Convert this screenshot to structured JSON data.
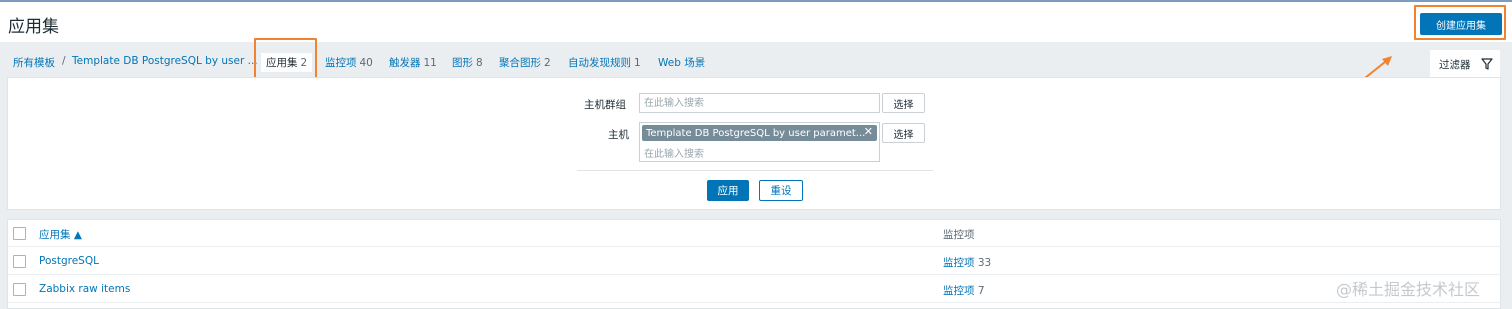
{
  "header": {
    "title": "应用集",
    "create_button": "创建应用集"
  },
  "nav": {
    "all_templates": "所有模板",
    "separator": "/",
    "template_name": "Template DB PostgreSQL by user ...",
    "tabs": [
      {
        "label": "应用集",
        "count": "2"
      },
      {
        "label": "监控项",
        "count": "40"
      },
      {
        "label": "触发器",
        "count": "11"
      },
      {
        "label": "图形",
        "count": "8"
      },
      {
        "label": "聚合图形",
        "count": "2"
      },
      {
        "label": "自动发现规则",
        "count": "1"
      },
      {
        "label": "Web 场景",
        "count": ""
      }
    ],
    "filter_tab": "过滤器"
  },
  "filter": {
    "host_group_label": "主机群组",
    "host_group_placeholder": "在此输入搜索",
    "select_label": "选择",
    "host_label": "主机",
    "host_chip": "Template DB PostgreSQL by user paramet...",
    "host_placeholder": "在此输入搜索",
    "apply": "应用",
    "reset": "重设"
  },
  "table": {
    "col_name": "应用集 ▲",
    "col_items": "监控项",
    "rows": [
      {
        "name": "PostgreSQL",
        "items_link": "监控项",
        "items_count": "33"
      },
      {
        "name": "Zabbix raw items",
        "items_link": "监控项",
        "items_count": "7"
      }
    ]
  },
  "watermark": "@稀土掘金技术社区",
  "colors": {
    "accent": "#0275b8",
    "highlight": "#f08230",
    "chip": "#768d99"
  }
}
